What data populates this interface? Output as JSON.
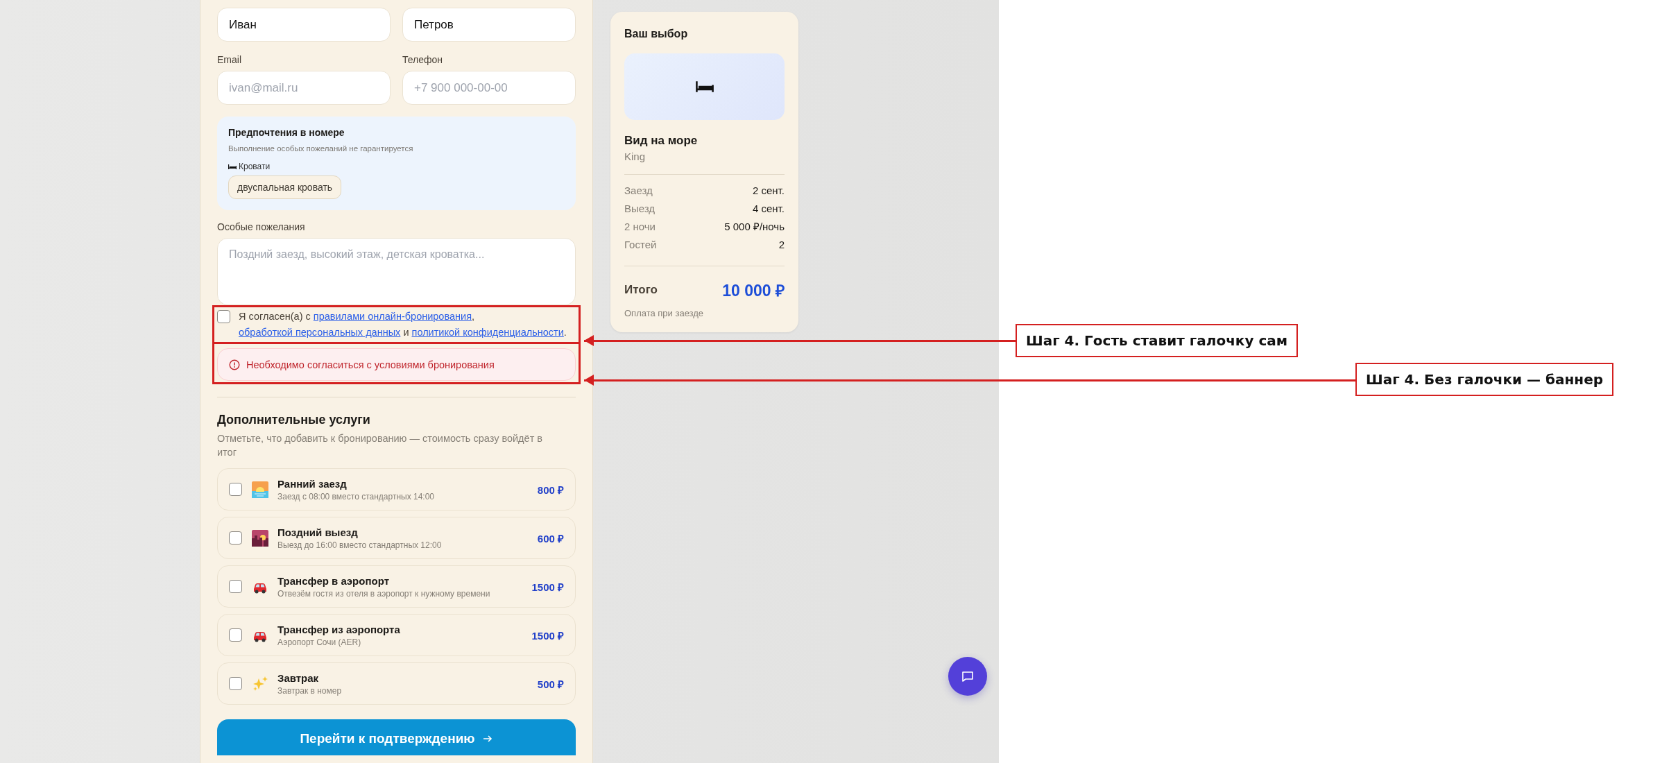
{
  "form": {
    "name_fields": [
      {
        "value": "Иван"
      },
      {
        "value": "Петров"
      }
    ],
    "contact_fields": [
      {
        "label": "Email",
        "placeholder": "ivan@mail.ru"
      },
      {
        "label": "Телефон",
        "placeholder": "+7 900 000-00-00"
      }
    ],
    "preferences": {
      "title": "Предпочтения в номере",
      "note": "Выполнение особых пожеланий не гарантируется",
      "group_label": "Кровати",
      "options": [
        "двуспальная кровать"
      ]
    },
    "special_requests": {
      "label": "Особые пожелания",
      "placeholder": "Поздний заезд, высокий этаж, детская кроватка..."
    },
    "consent": {
      "checked": false,
      "parts": [
        {
          "kind": "text",
          "text": "Я согласен(а) с "
        },
        {
          "kind": "link",
          "text": "правилами онлайн-бронирования"
        },
        {
          "kind": "text",
          "text": ", "
        },
        {
          "kind": "link",
          "text": "обработкой персональных данных"
        },
        {
          "kind": "text",
          "text": " и "
        },
        {
          "kind": "link",
          "text": "политикой конфиденциальности"
        },
        {
          "kind": "text",
          "text": "."
        }
      ]
    },
    "error_banner": {
      "text": "Необходимо согласиться с условиями бронирования"
    },
    "extras": {
      "title": "Дополнительные услуги",
      "subtitle": "Отметьте, что добавить к бронированию — стоимость сразу войдёт в итог",
      "items": [
        {
          "title": "Ранний заезд",
          "description": "Заезд с 08:00 вместо стандартных 14:00",
          "price": "800 ₽",
          "checked": false
        },
        {
          "title": "Поздний выезд",
          "description": "Выезд до 16:00 вместо стандартных 12:00",
          "price": "600 ₽",
          "checked": false
        },
        {
          "title": "Трансфер в аэропорт",
          "description": "Отвезём гостя из отеля в аэропорт к нужному времени",
          "price": "1500 ₽",
          "checked": false
        },
        {
          "title": "Трансфер из аэропорта",
          "description": "Аэропорт Сочи (AER)",
          "price": "1500 ₽",
          "checked": false
        },
        {
          "title": "Завтрак",
          "description": "Завтрак в номер",
          "price": "500 ₽",
          "checked": false
        }
      ]
    },
    "submit_button": "Перейти к подтверждению"
  },
  "summary": {
    "title": "Ваш выбор",
    "room_name": "Вид на море",
    "room_type": "King",
    "rows": [
      {
        "label": "Заезд",
        "value": "2 сент."
      },
      {
        "label": "Выезд",
        "value": "4 сент."
      },
      {
        "label": "2 ночи",
        "value": "5 000 ₽/ночь"
      },
      {
        "label": "Гостей",
        "value": "2"
      }
    ],
    "total_label": "Итого",
    "total_value": "10 000 ₽",
    "payment_note": "Оплата при заезде"
  },
  "annotations": [
    {
      "text": "Шаг 4. Гость ставит галочку сам"
    },
    {
      "text": "Шаг 4. Без галочки — баннер"
    }
  ]
}
